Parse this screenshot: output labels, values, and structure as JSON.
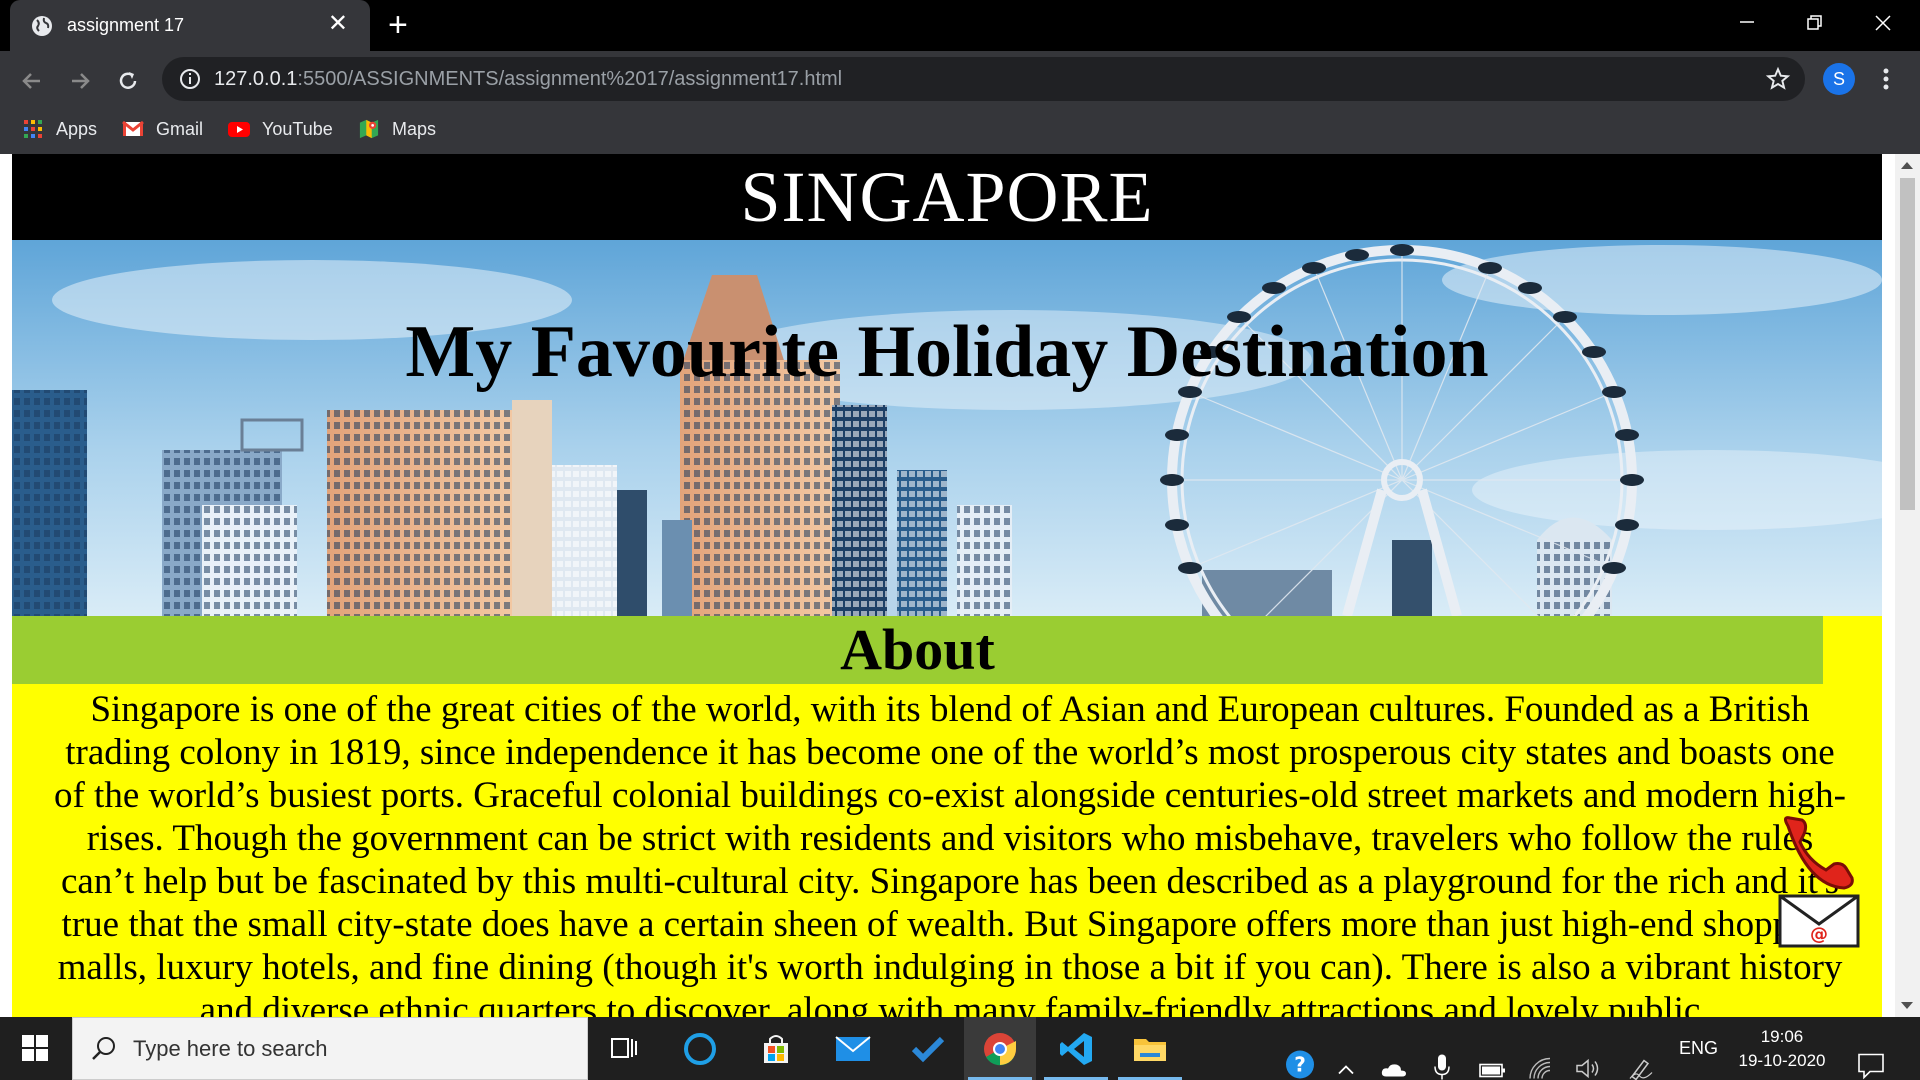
{
  "browser": {
    "tab_title": "assignment 17",
    "url_host": "127.0.0.1",
    "url_rest": ":5500/ASSIGNMENTS/assignment%2017/assignment17.html",
    "profile_initial": "S",
    "bookmarks": [
      {
        "label": "Apps",
        "icon": "apps-grid-icon"
      },
      {
        "label": "Gmail",
        "icon": "gmail-icon"
      },
      {
        "label": "YouTube",
        "icon": "youtube-icon"
      },
      {
        "label": "Maps",
        "icon": "maps-icon"
      }
    ]
  },
  "page": {
    "header_title": "SINGAPORE",
    "hero_title": "My Favourite Holiday Destination",
    "about_heading": "About",
    "about_text": "Singapore is one of the great cities of the world, with its blend of Asian and European cultures. Founded as a British trading colony in 1819, since independence it has become one of the world’s most prosperous city states and boasts one of the world’s busiest ports. Graceful colonial buildings co-exist alongside centuries-old street markets and modern high-rises. Though the government can be strict with residents and visitors who misbehave, travelers who follow the rules can’t help but be fascinated by this multi-cultural city. Singapore has been described as a playground for the rich and it's true that the small city-state does have a certain sheen of wealth. But Singapore offers more than just high-end shopping malls, luxury hotels, and fine dining (though it's worth indulging in those a bit if you can). There is also a vibrant history and diverse ethnic quarters to discover, along with many family-friendly attractions and lovely public",
    "colors": {
      "header_bg": "#000000",
      "about_head_bg": "#9acd32",
      "about_bg": "#ffff00"
    }
  },
  "taskbar": {
    "search_placeholder": "Type here to search",
    "language": "ENG",
    "time": "19:06",
    "date": "19-10-2020",
    "pinned": [
      "task-view-icon",
      "cortana-icon",
      "store-icon",
      "mail-icon",
      "todo-icon",
      "chrome-icon",
      "vscode-icon",
      "file-explorer-icon"
    ]
  }
}
